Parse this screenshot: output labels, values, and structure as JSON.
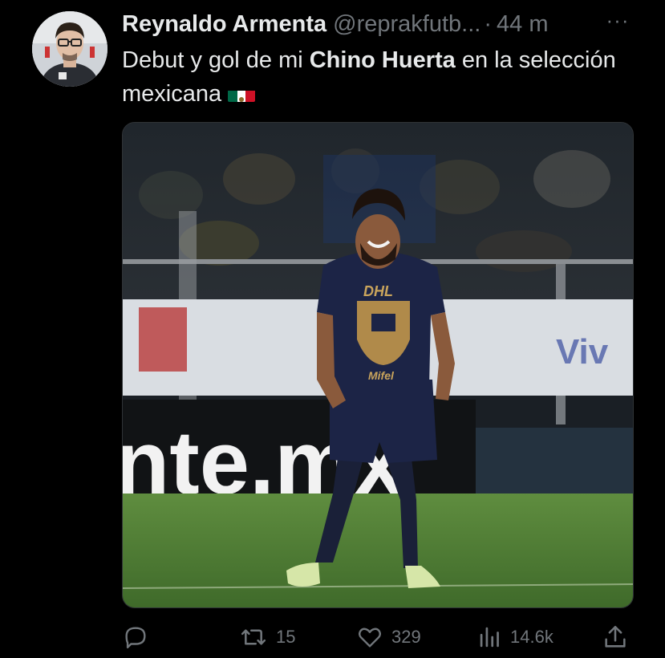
{
  "tweet": {
    "author": {
      "display_name": "Reynaldo Armenta",
      "handle": "@reprakfutb...",
      "separator": "·",
      "time": "44 m"
    },
    "more_label": "···",
    "text": {
      "part1": "Debut y gol de mi ",
      "bold": "Chino Huerta",
      "part2": " en la selección mexicana"
    },
    "flag_icon": "mexico-flag-icon",
    "media": {
      "ad_board_text": "nte.mx",
      "shirt_sponsor": "DHL",
      "shirt_sponsor_2": "Mifel"
    },
    "actions": {
      "reply": {
        "icon": "reply-icon",
        "count": ""
      },
      "retweet": {
        "icon": "retweet-icon",
        "count": "15"
      },
      "like": {
        "icon": "heart-icon",
        "count": "329"
      },
      "views": {
        "icon": "views-icon",
        "count": "14.6k"
      },
      "share": {
        "icon": "share-icon",
        "count": ""
      }
    },
    "colors": {
      "background": "#000000",
      "text": "#e7e9ea",
      "secondary": "#71767b"
    }
  }
}
